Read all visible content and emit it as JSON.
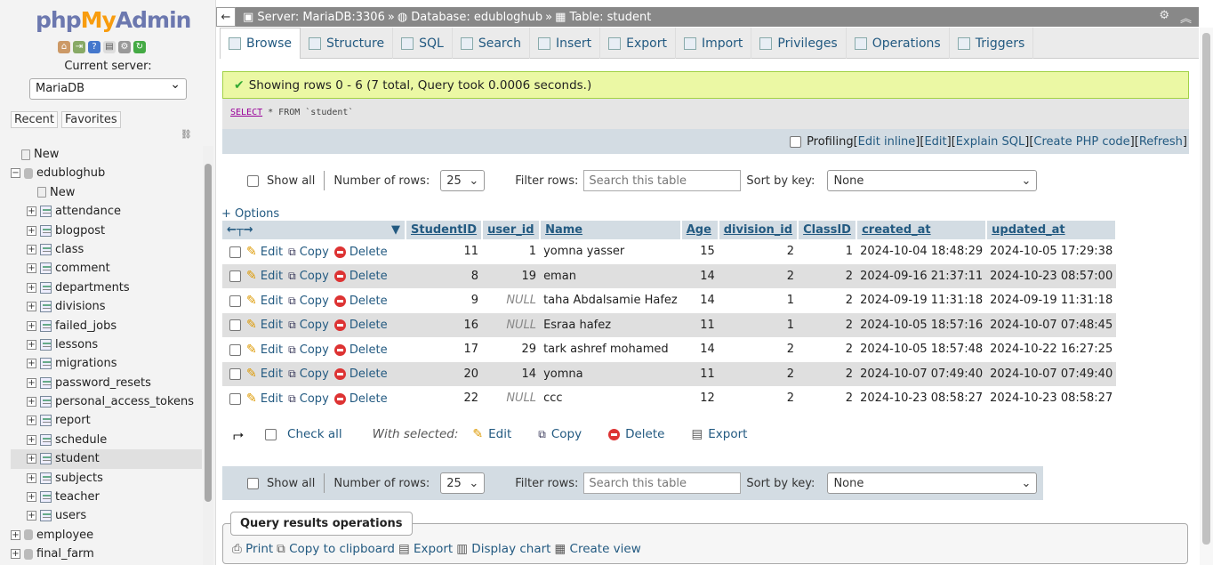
{
  "logo": {
    "php": "php",
    "my": "My",
    "admin": "Admin"
  },
  "sidebar": {
    "current_server_label": "Current server:",
    "server_value": "MariaDB",
    "recent": "Recent",
    "favorites": "Favorites",
    "tree": [
      {
        "label": "New",
        "level": 1,
        "kind": "new"
      },
      {
        "label": "edubloghub",
        "level": 0,
        "kind": "db",
        "expanded": true
      },
      {
        "label": "New",
        "level": 2,
        "kind": "new"
      },
      {
        "label": "attendance",
        "level": 1,
        "kind": "table"
      },
      {
        "label": "blogpost",
        "level": 1,
        "kind": "table"
      },
      {
        "label": "class",
        "level": 1,
        "kind": "table"
      },
      {
        "label": "comment",
        "level": 1,
        "kind": "table"
      },
      {
        "label": "departments",
        "level": 1,
        "kind": "table"
      },
      {
        "label": "divisions",
        "level": 1,
        "kind": "table"
      },
      {
        "label": "failed_jobs",
        "level": 1,
        "kind": "table"
      },
      {
        "label": "lessons",
        "level": 1,
        "kind": "table"
      },
      {
        "label": "migrations",
        "level": 1,
        "kind": "table"
      },
      {
        "label": "password_resets",
        "level": 1,
        "kind": "table"
      },
      {
        "label": "personal_access_tokens",
        "level": 1,
        "kind": "table"
      },
      {
        "label": "report",
        "level": 1,
        "kind": "table"
      },
      {
        "label": "schedule",
        "level": 1,
        "kind": "table"
      },
      {
        "label": "student",
        "level": 1,
        "kind": "table",
        "selected": true
      },
      {
        "label": "subjects",
        "level": 1,
        "kind": "table"
      },
      {
        "label": "teacher",
        "level": 1,
        "kind": "table"
      },
      {
        "label": "users",
        "level": 1,
        "kind": "table"
      },
      {
        "label": "employee",
        "level": 0,
        "kind": "db"
      },
      {
        "label": "final_farm",
        "level": 0,
        "kind": "db"
      }
    ]
  },
  "breadcrumb": {
    "server": "Server: MariaDB:3306",
    "database": "Database: edubloghub",
    "table": "Table: student",
    "sep": "»"
  },
  "tabs": [
    "Browse",
    "Structure",
    "SQL",
    "Search",
    "Insert",
    "Export",
    "Import",
    "Privileges",
    "Operations",
    "Triggers"
  ],
  "message": "Showing rows 0 - 6 (7 total, Query took 0.0006 seconds.)",
  "sql": {
    "kw": "SELECT",
    "rest": " * FROM `student`"
  },
  "profiling": {
    "label": "Profiling",
    "links": [
      "Edit inline",
      "Edit",
      "Explain SQL",
      "Create PHP code",
      "Refresh"
    ]
  },
  "controls": {
    "show_all": "Show all",
    "num_rows_label": "Number of rows:",
    "num_rows": "25",
    "filter_label": "Filter rows:",
    "filter_placeholder": "Search this table",
    "sort_label": "Sort by key:",
    "sort_value": "None"
  },
  "options_link": "+ Options",
  "columns": [
    "StudentID",
    "user_id",
    "Name",
    "Age",
    "division_id",
    "ClassID",
    "created_at",
    "updated_at"
  ],
  "row_actions": {
    "edit": "Edit",
    "copy": "Copy",
    "delete": "Delete"
  },
  "rows": [
    [
      "11",
      "1",
      "yomna yasser",
      "15",
      "2",
      "1",
      "2024-10-04 18:48:29",
      "2024-10-05 17:29:38"
    ],
    [
      "8",
      "19",
      "eman",
      "14",
      "2",
      "2",
      "2024-09-16 21:37:11",
      "2024-10-23 08:57:00"
    ],
    [
      "9",
      "NULL",
      "taha Abdalsamie Hafez",
      "14",
      "1",
      "2",
      "2024-09-19 11:31:18",
      "2024-09-19 11:31:18"
    ],
    [
      "16",
      "NULL",
      "Esraa hafez",
      "11",
      "1",
      "2",
      "2024-10-05 18:57:16",
      "2024-10-07 07:48:45"
    ],
    [
      "17",
      "29",
      "tark ashref mohamed",
      "14",
      "2",
      "2",
      "2024-10-05 18:57:48",
      "2024-10-22 16:27:25"
    ],
    [
      "20",
      "14",
      "yomna",
      "11",
      "2",
      "2",
      "2024-10-07 07:49:40",
      "2024-10-07 07:49:40"
    ],
    [
      "22",
      "NULL",
      "ccc",
      "12",
      "2",
      "2",
      "2024-10-23 08:58:27",
      "2024-10-23 08:58:27"
    ]
  ],
  "with_selected": {
    "check_all": "Check all",
    "label": "With selected:",
    "edit": "Edit",
    "copy": "Copy",
    "delete": "Delete",
    "export": "Export"
  },
  "query_ops": {
    "legend": "Query results operations",
    "items": [
      "Print",
      "Copy to clipboard",
      "Export",
      "Display chart",
      "Create view"
    ]
  }
}
